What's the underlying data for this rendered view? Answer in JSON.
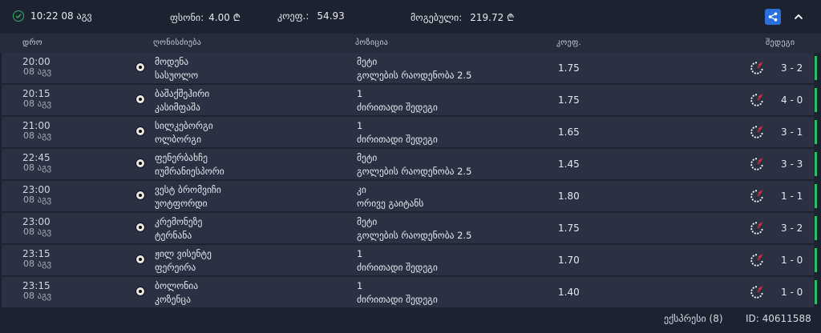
{
  "header": {
    "time": "10:22 08 აგვ",
    "stake_label": "ფსონი:",
    "stake_value": "4.00 ₾",
    "odds_label": "კოეფ.:",
    "odds_value": "54.93",
    "win_label": "მოგებული:",
    "win_value": "219.72 ₾"
  },
  "columns": {
    "time": "დრო",
    "event": "ღონისძიება",
    "position": "პოზიცია",
    "odds": "კოეფ.",
    "result": "შედეგი"
  },
  "rows": [
    {
      "time": "20:00",
      "date": "08 აგვ",
      "team1": "მოდენა",
      "team2": "სასუოლო",
      "pos1": "მეტი",
      "pos2": "გოლების რაოდენობა 2.5",
      "odd": "1.75",
      "score": "3 - 2"
    },
    {
      "time": "20:15",
      "date": "08 აგვ",
      "team1": "ბაშაქშეჰირი",
      "team2": "კასიმფაშა",
      "pos1": "1",
      "pos2": "ძირითადი შედეგი",
      "odd": "1.75",
      "score": "4 - 0"
    },
    {
      "time": "21:00",
      "date": "08 აგვ",
      "team1": "სილკებორგი",
      "team2": "ოლბორგი",
      "pos1": "1",
      "pos2": "ძირითადი შედეგი",
      "odd": "1.65",
      "score": "3 - 1"
    },
    {
      "time": "22:45",
      "date": "08 აგვ",
      "team1": "ფენერბახჩე",
      "team2": "იუმრანიესპორი",
      "pos1": "მეტი",
      "pos2": "გოლების რაოდენობა 2.5",
      "odd": "1.45",
      "score": "3 - 3"
    },
    {
      "time": "23:00",
      "date": "08 აგვ",
      "team1": "ვესტ ბრომვიჩი",
      "team2": "უოტფორდი",
      "pos1": "კი",
      "pos2": "ორივე გაიტანს",
      "odd": "1.80",
      "score": "1 - 1"
    },
    {
      "time": "23:00",
      "date": "08 აგვ",
      "team1": "კრემონეზე",
      "team2": "ტერნანა",
      "pos1": "მეტი",
      "pos2": "გოლების რაოდენობა 2.5",
      "odd": "1.75",
      "score": "3 - 2"
    },
    {
      "time": "23:15",
      "date": "08 აგვ",
      "team1": "ჟილ ვისენტე",
      "team2": "ფერეირა",
      "pos1": "1",
      "pos2": "ძირითადი შედეგი",
      "odd": "1.70",
      "score": "1 - 0"
    },
    {
      "time": "23:15",
      "date": "08 აგვ",
      "team1": "ბოლონია",
      "team2": "კოზენცა",
      "pos1": "1",
      "pos2": "ძირითადი შედეგი",
      "odd": "1.40",
      "score": "1 - 0"
    }
  ],
  "footer": {
    "express": "ექსპრესი (8)",
    "id": "ID: 40611588"
  },
  "colors": {
    "background": "#1d2230",
    "row": "#2b3142",
    "win": "#2fbd6a",
    "accent": "#2a6fdb",
    "icon_red": "#e0303a"
  },
  "icons": {
    "status": "check-circle-icon",
    "share": "share-icon",
    "collapse": "chevron-up-icon",
    "sport": "soccer-ball-icon",
    "result": "stopwatch-icon"
  }
}
